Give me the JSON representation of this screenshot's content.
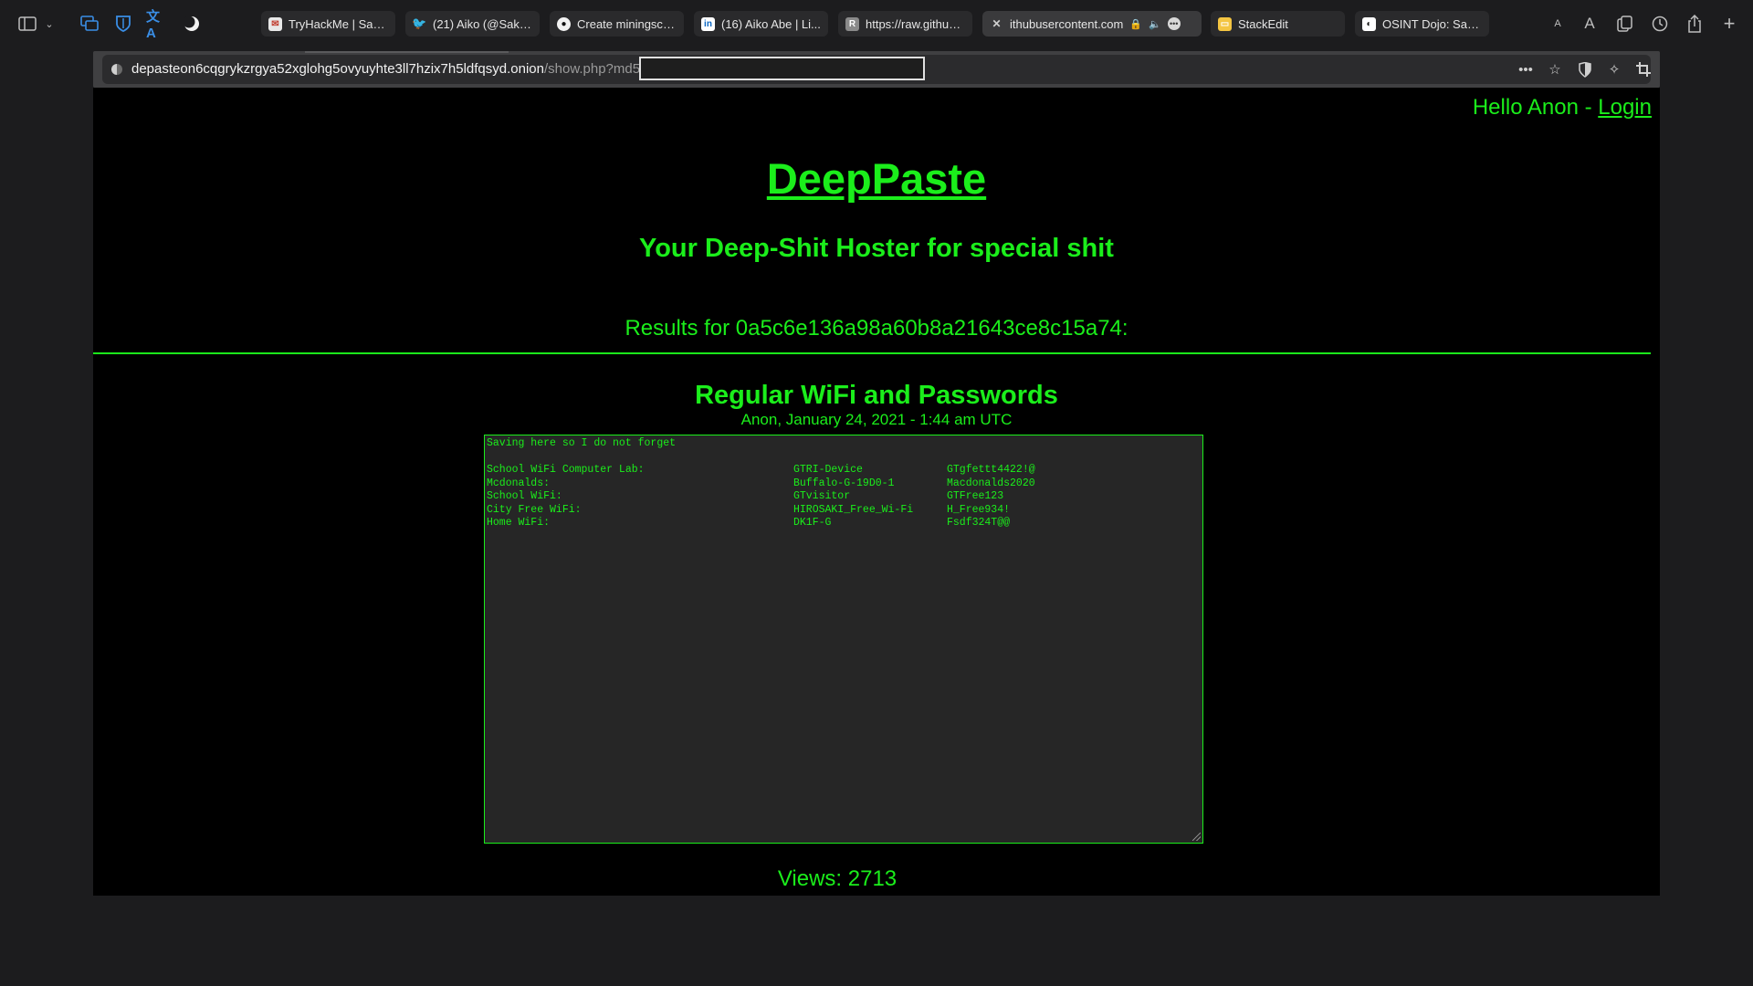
{
  "browser": {
    "tabs": [
      {
        "title": "TryHackMe | Sak...",
        "icon": "tryhackme-icon",
        "active": false
      },
      {
        "title": "(21) Aiko (@Saku...",
        "icon": "twitter-icon",
        "active": false
      },
      {
        "title": "Create miningscri...",
        "icon": "github-icon",
        "active": false
      },
      {
        "title": "(16) Aiko Abe | Li...",
        "icon": "linkedin-icon",
        "active": false
      },
      {
        "title": "https://raw.github...",
        "icon": "raw-icon",
        "active": false
      },
      {
        "title": "ithubusercontent.com",
        "icon": "close-icon",
        "active": true
      },
      {
        "title": "StackEdit",
        "icon": "stackedit-icon",
        "active": false
      },
      {
        "title": "OSINT Dojo: Sak...",
        "icon": "osintdojo-icon",
        "active": false
      }
    ],
    "url": {
      "host": "depasteon6cqgrykzrgya52xglohg5ovyuyhte3ll7hzix7h5ldfqsyd.onion",
      "path": "/show.php?md5="
    },
    "reader_small": "A",
    "reader_large": "A"
  },
  "page": {
    "hello_text": "Hello Anon - ",
    "login_label": "Login",
    "brand": "DeepPaste",
    "tagline": "Your Deep-Shit Hoster for special shit",
    "results_label": "Results for 0a5c6e136a98a60b8a21643ce8c15a74:",
    "paste": {
      "title": "Regular WiFi and Passwords",
      "meta": "Anon, January 24, 2021 - 1:44 am UTC",
      "intro": "Saving here so I do not forget",
      "rows": [
        [
          "School WiFi Computer Lab:",
          "GTRI-Device",
          "GTgfettt4422!@"
        ],
        [
          "Mcdonalds:",
          "Buffalo-G-19D0-1",
          "Macdonalds2020"
        ],
        [
          "School WiFi:",
          "GTvisitor",
          "GTFree123"
        ],
        [
          "City Free WiFi:",
          "HIROSAKI_Free_Wi-Fi",
          "H_Free934!"
        ],
        [
          "Home WiFi:",
          "DK1F-G",
          "Fsdf324T@@"
        ]
      ]
    },
    "views_label": "Views: 2713"
  }
}
